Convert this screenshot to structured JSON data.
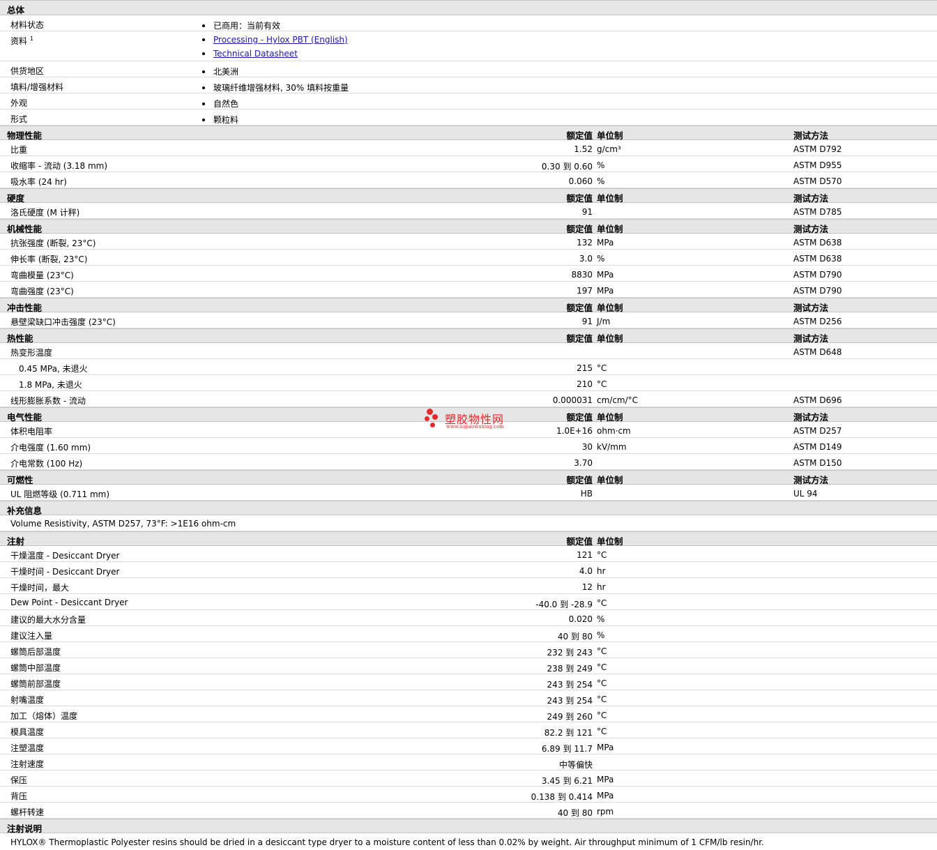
{
  "column_headers": {
    "value": "额定值",
    "unit": "单位制",
    "method": "测试方法"
  },
  "general": {
    "title": "总体",
    "material_status_label": "材料状态",
    "material_status_value": "已商用：当前有效",
    "docs_label": "资料",
    "docs_sup": "1",
    "docs_link1": "Processing - Hylox PBT (English)",
    "docs_link2": "Technical Datasheet",
    "region_label": "供货地区",
    "region_value": "北美洲",
    "filler_label": "填料/增强材料",
    "filler_value": "玻璃纤维增强材料, 30% 填料按重量",
    "appearance_label": "外观",
    "appearance_value": "自然色",
    "form_label": "形式",
    "form_value": "颗粒料"
  },
  "physical": {
    "title": "物理性能",
    "rows": [
      {
        "label": "比重",
        "value": "1.52",
        "unit": "g/cm³",
        "method": "ASTM D792"
      },
      {
        "label": "收缩率  - 流动  (3.18 mm)",
        "value": "0.30 到  0.60",
        "unit": "%",
        "method": "ASTM D955"
      },
      {
        "label": "吸水率  (24 hr)",
        "value": "0.060",
        "unit": "%",
        "method": "ASTM D570"
      }
    ]
  },
  "hardness": {
    "title": "硬度",
    "rows": [
      {
        "label": "洛氏硬度  (M 计秤)",
        "value": "91",
        "unit": "",
        "method": "ASTM D785"
      }
    ]
  },
  "mechanical": {
    "title": "机械性能",
    "rows": [
      {
        "label": "抗张强度  (断裂, 23°C)",
        "value": "132",
        "unit": "MPa",
        "method": "ASTM D638"
      },
      {
        "label": "伸长率  (断裂, 23°C)",
        "value": "3.0",
        "unit": "%",
        "method": "ASTM D638"
      },
      {
        "label": "弯曲模量  (23°C)",
        "value": "8830",
        "unit": "MPa",
        "method": "ASTM D790"
      },
      {
        "label": "弯曲强度  (23°C)",
        "value": "197",
        "unit": "MPa",
        "method": "ASTM D790"
      }
    ]
  },
  "impact": {
    "title": "冲击性能",
    "rows": [
      {
        "label": "悬壁梁缺口冲击强度  (23°C)",
        "value": "91",
        "unit": "J/m",
        "method": "ASTM D256"
      }
    ]
  },
  "thermal": {
    "title": "热性能",
    "rows": [
      {
        "label": "热变形温度",
        "value": "",
        "unit": "",
        "method": "ASTM D648"
      },
      {
        "label": "0.45 MPa, 未退火",
        "value": "215",
        "unit": "°C",
        "method": ""
      },
      {
        "label": "1.8 MPa, 未退火",
        "value": "210",
        "unit": "°C",
        "method": ""
      },
      {
        "label": "线形膨胀系数  - 流动",
        "value": "0.000031",
        "unit": "cm/cm/°C",
        "method": "ASTM D696"
      }
    ]
  },
  "electrical": {
    "title": "电气性能",
    "rows": [
      {
        "label": "体积电阻率",
        "value": "1.0E+16",
        "unit": "ohm·cm",
        "method": "ASTM D257"
      },
      {
        "label": "介电强度  (1.60 mm)",
        "value": "30",
        "unit": "kV/mm",
        "method": "ASTM D149"
      },
      {
        "label": "介电常数  (100 Hz)",
        "value": "3.70",
        "unit": "",
        "method": "ASTM D150"
      }
    ]
  },
  "flammability": {
    "title": "可燃性",
    "rows": [
      {
        "label": "UL 阻燃等级  (0.711 mm)",
        "value": "HB",
        "unit": "",
        "method": "UL 94"
      }
    ]
  },
  "supplement": {
    "title": "补充信息",
    "note": "Volume Resistivity, ASTM D257, 73°F: >1E16 ohm-cm"
  },
  "injection": {
    "title": "注射",
    "rows": [
      {
        "label": "干燥温度  - Desiccant Dryer",
        "value": "121",
        "unit": "°C"
      },
      {
        "label": "干燥时间  - Desiccant Dryer",
        "value": "4.0",
        "unit": "hr"
      },
      {
        "label": "干燥时间，最大",
        "value": "12",
        "unit": "hr"
      },
      {
        "label": "Dew Point - Desiccant Dryer",
        "value": "-40.0 到  -28.9",
        "unit": "°C"
      },
      {
        "label": "建议的最大水分含量",
        "value": "0.020",
        "unit": "%"
      },
      {
        "label": "建议注入量",
        "value": "40 到  80",
        "unit": "%"
      },
      {
        "label": "螺筒后部温度",
        "value": "232 到  243",
        "unit": "°C"
      },
      {
        "label": "螺筒中部温度",
        "value": "238 到  249",
        "unit": "°C"
      },
      {
        "label": "螺筒前部温度",
        "value": "243 到  254",
        "unit": "°C"
      },
      {
        "label": "射嘴温度",
        "value": "243 到  254",
        "unit": "°C"
      },
      {
        "label": "加工（熔体）温度",
        "value": "249 到  260",
        "unit": "°C"
      },
      {
        "label": "模具温度",
        "value": "82.2 到  121",
        "unit": "°C"
      },
      {
        "label": "注塑温度",
        "value": "6.89 到  11.7",
        "unit": "MPa"
      },
      {
        "label": "注射速度",
        "value": "中等偏快",
        "unit": ""
      },
      {
        "label": "保压",
        "value": "3.45 到  6.21",
        "unit": "MPa"
      },
      {
        "label": "背压",
        "value": "0.138 到  0.414",
        "unit": "MPa"
      },
      {
        "label": "螺杆转速",
        "value": "40 到  80",
        "unit": "rpm"
      }
    ]
  },
  "injection_notes": {
    "title": "注射说明",
    "text": "HYLOX® Thermoplastic Polyester resins should be dried in a desiccant type dryer to a moisture content of less than 0.02% by weight. Air throughput minimum of 1 CFM/lb resin/hr."
  },
  "watermark": {
    "text": "塑胶物性网",
    "url": "www.sujiaowuxing.com",
    "color": "#e62a2a"
  }
}
